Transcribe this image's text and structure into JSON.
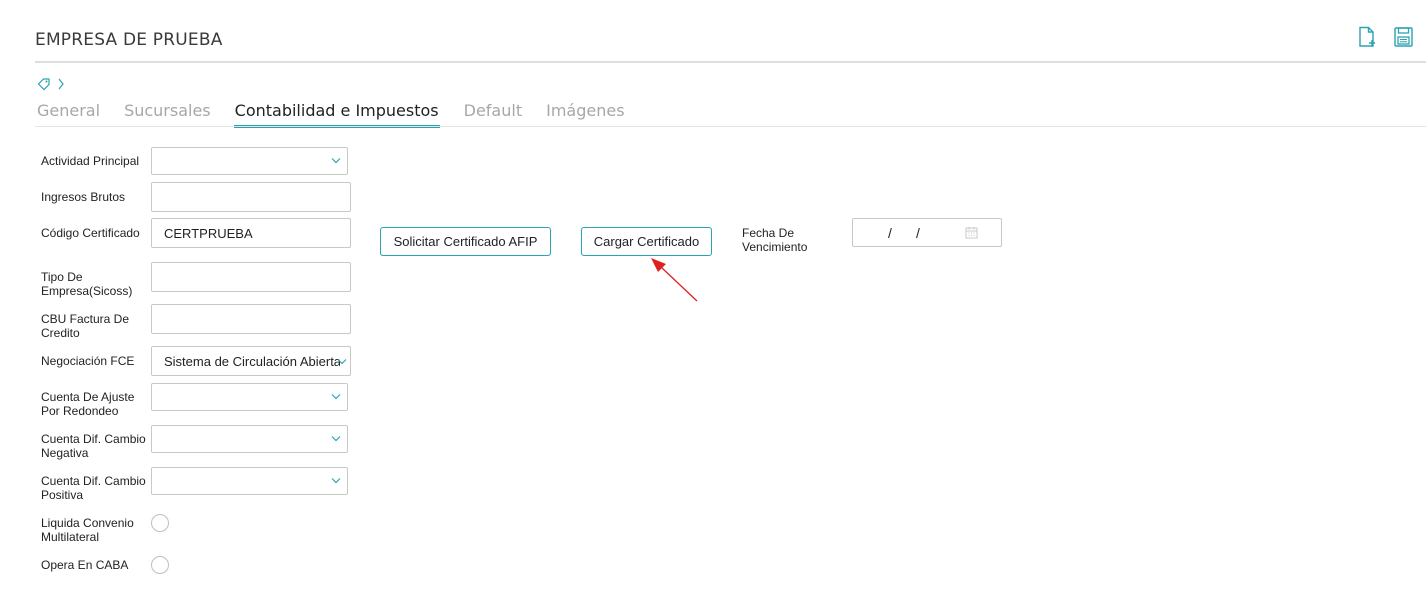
{
  "header": {
    "title": "EMPRESA DE PRUEBA",
    "icons": [
      "new-document-icon",
      "save-icon"
    ]
  },
  "breadcrumb": {
    "icons": [
      "tag-icon",
      "chevron-right-icon"
    ]
  },
  "tabs": [
    {
      "label": "General",
      "active": false
    },
    {
      "label": "Sucursales",
      "active": false
    },
    {
      "label": "Contabilidad e Impuestos",
      "active": true
    },
    {
      "label": "Default",
      "active": false
    },
    {
      "label": "Imágenes",
      "active": false
    }
  ],
  "form": {
    "actividad_principal": {
      "label": "Actividad Principal",
      "value": ""
    },
    "ingresos_brutos": {
      "label": "Ingresos Brutos",
      "value": ""
    },
    "codigo_certificado": {
      "label": "Código Certificado",
      "value": "CERTPRUEBA"
    },
    "tipo_empresa": {
      "label": "Tipo De Empresa(Sicoss)",
      "value": ""
    },
    "cbu_factura": {
      "label": "CBU Factura De Credito",
      "value": ""
    },
    "negociacion_fce": {
      "label": "Negociación FCE",
      "value": "Sistema de Circulación Abierta"
    },
    "cuenta_ajuste": {
      "label": "Cuenta De Ajuste Por Redondeo",
      "value": ""
    },
    "cuenta_negativa": {
      "label": "Cuenta Dif. Cambio Negativa",
      "value": ""
    },
    "cuenta_positiva": {
      "label": "Cuenta Dif. Cambio Positiva",
      "value": ""
    },
    "liquida_convenio": {
      "label": "Liquida Convenio Multilateral",
      "checked": false
    },
    "opera_caba": {
      "label": "Opera En CABA",
      "checked": false
    }
  },
  "buttons": {
    "solicitar": "Solicitar Certificado AFIP",
    "cargar": "Cargar Certificado"
  },
  "fecha_vencimiento": {
    "label": "Fecha De Vencimiento",
    "sep1": "/",
    "sep2": "/"
  },
  "colors": {
    "accent": "#2aa3b3",
    "annotation_arrow": "#e0201f"
  }
}
